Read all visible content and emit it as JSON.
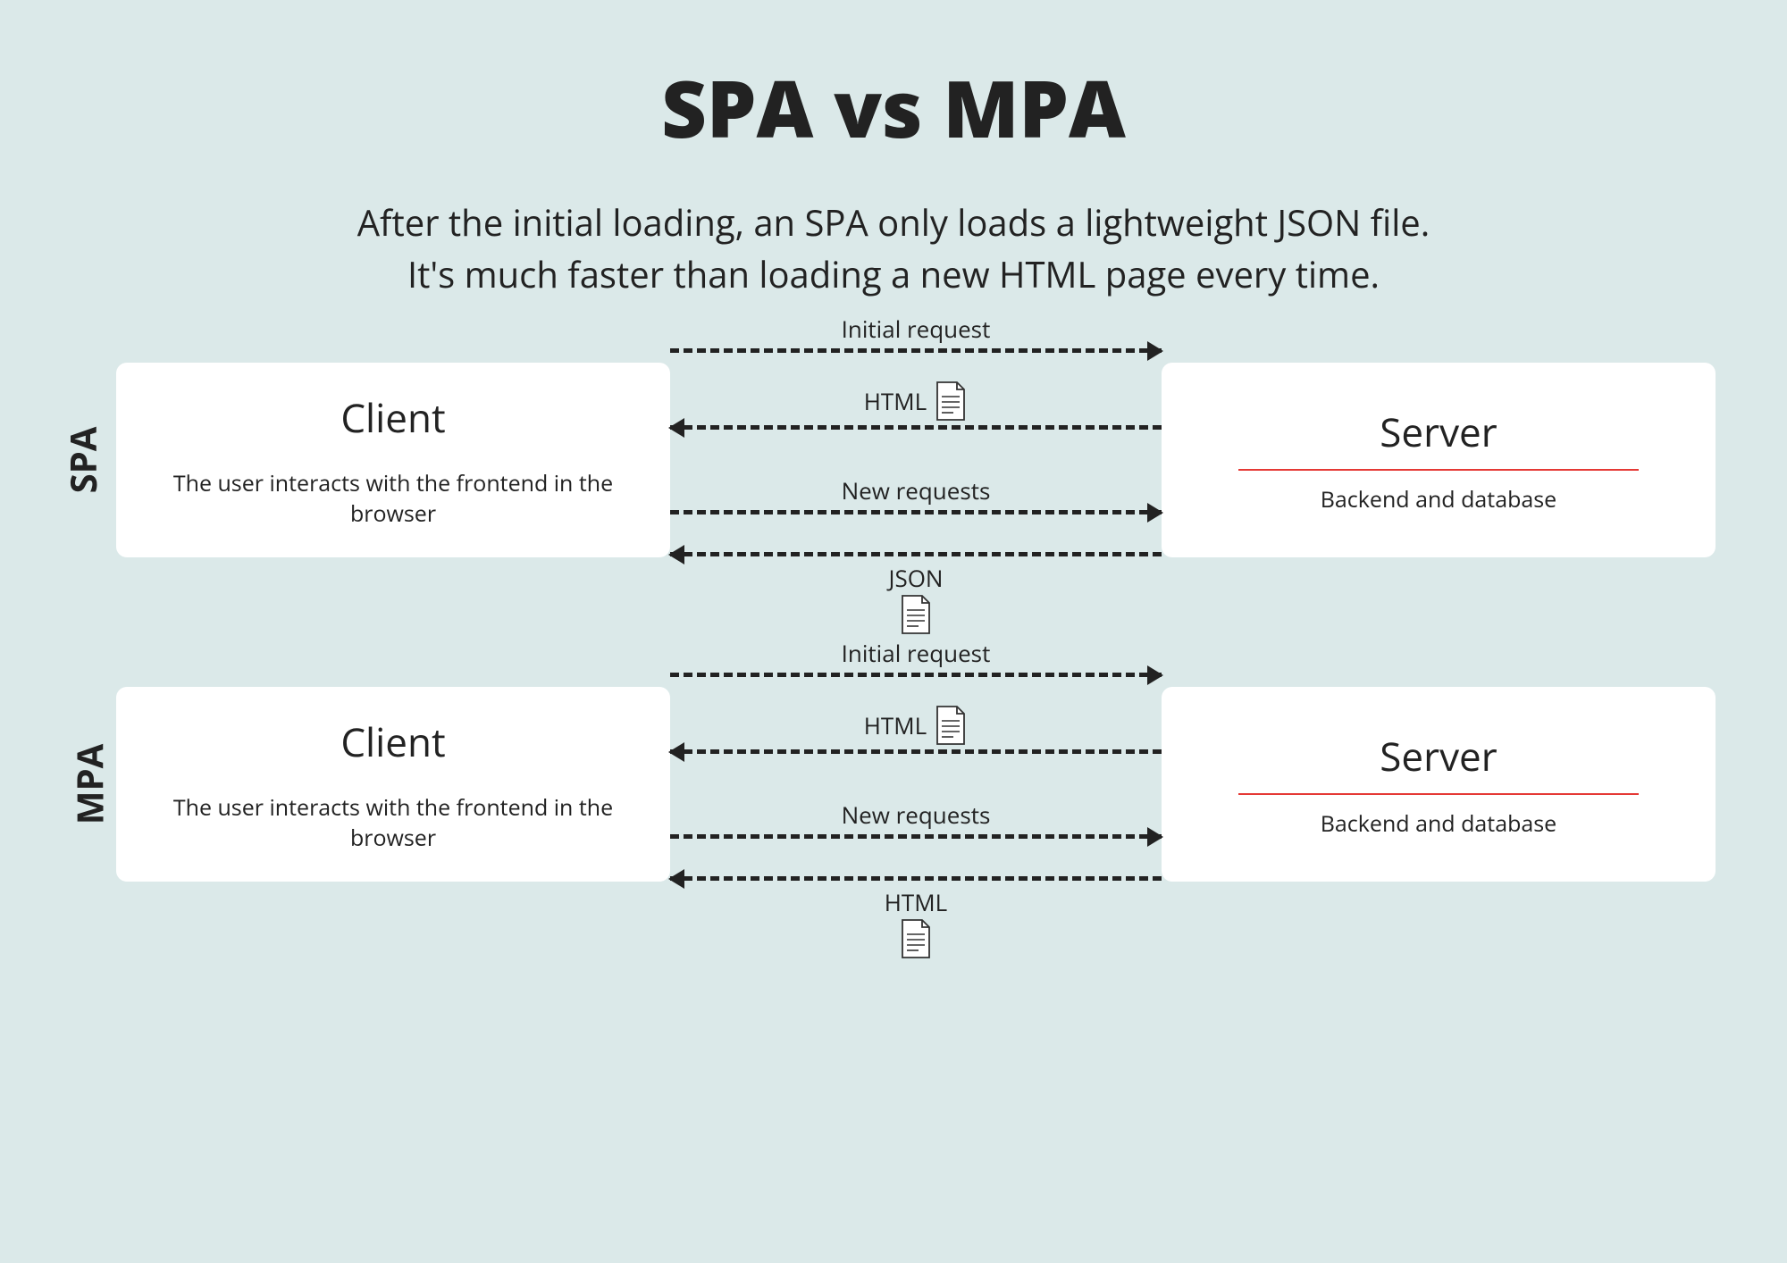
{
  "title": "SPA vs MPA",
  "subtitle_line1": "After the initial loading, an SPA only loads a lightweight JSON file.",
  "subtitle_line2": "It's much faster than loading a new HTML page every time.",
  "spa": {
    "section_label": "SPA",
    "client": {
      "title": "Client",
      "desc": "The user interacts with the frontend in the browser"
    },
    "server": {
      "title": "Server",
      "desc": "Backend and database"
    },
    "arrows": {
      "initial_request": "Initial request",
      "html_response": "HTML",
      "new_requests": "New requests",
      "json_response": "JSON"
    }
  },
  "mpa": {
    "section_label": "MPA",
    "client": {
      "title": "Client",
      "desc": "The user interacts with the frontend in the browser"
    },
    "server": {
      "title": "Server",
      "desc": "Backend and database"
    },
    "arrows": {
      "initial_request": "Initial request",
      "html_response": "HTML",
      "new_requests": "New requests",
      "html_response2": "HTML"
    }
  }
}
